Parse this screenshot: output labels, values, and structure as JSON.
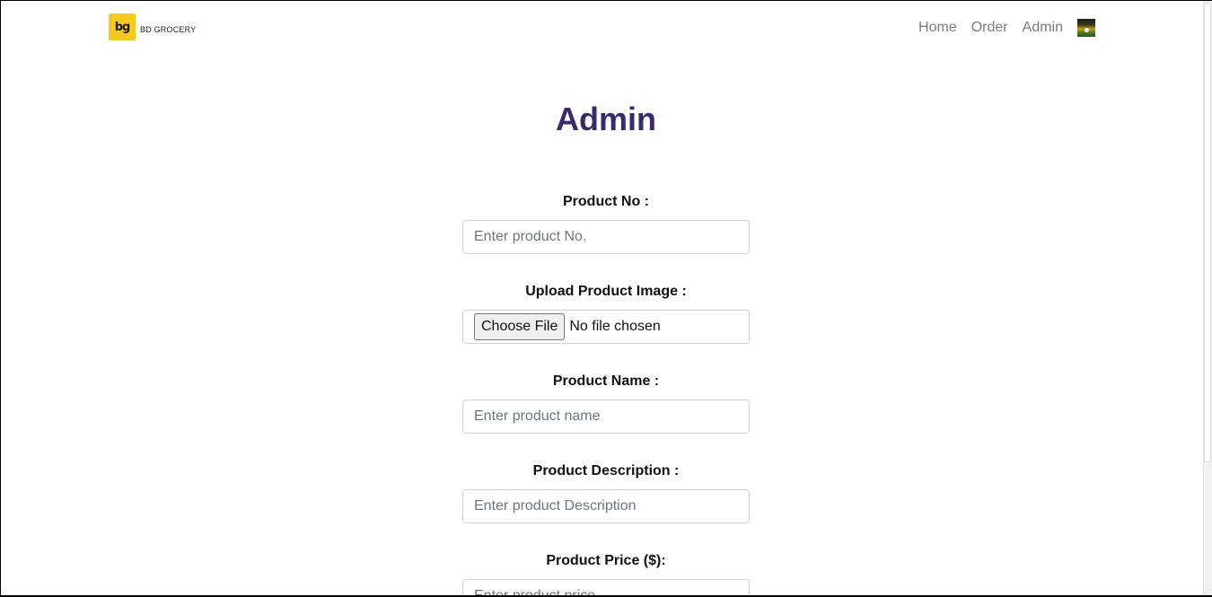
{
  "nav": {
    "logo_text": "bg",
    "brand_name": "BD GROCERY",
    "links": [
      {
        "label": "Home"
      },
      {
        "label": "Order"
      },
      {
        "label": "Admin"
      }
    ]
  },
  "page": {
    "title": "Admin"
  },
  "form": {
    "product_no": {
      "label": "Product No :",
      "placeholder": "Enter product No.",
      "value": ""
    },
    "product_image": {
      "label": "Upload Product Image :",
      "button_label": "Choose File",
      "status": "No file chosen"
    },
    "product_name": {
      "label": "Product Name :",
      "placeholder": "Enter product name",
      "value": ""
    },
    "product_description": {
      "label": "Product Description :",
      "placeholder": "Enter product Description",
      "value": ""
    },
    "product_price": {
      "label": "Product Price ($):",
      "placeholder": "Enter product price",
      "value": ""
    }
  },
  "colors": {
    "title": "#3a2a6b",
    "logo_bg": "#f7c81e",
    "nav_link": "#7a7a7a",
    "input_border": "#ced4da"
  }
}
